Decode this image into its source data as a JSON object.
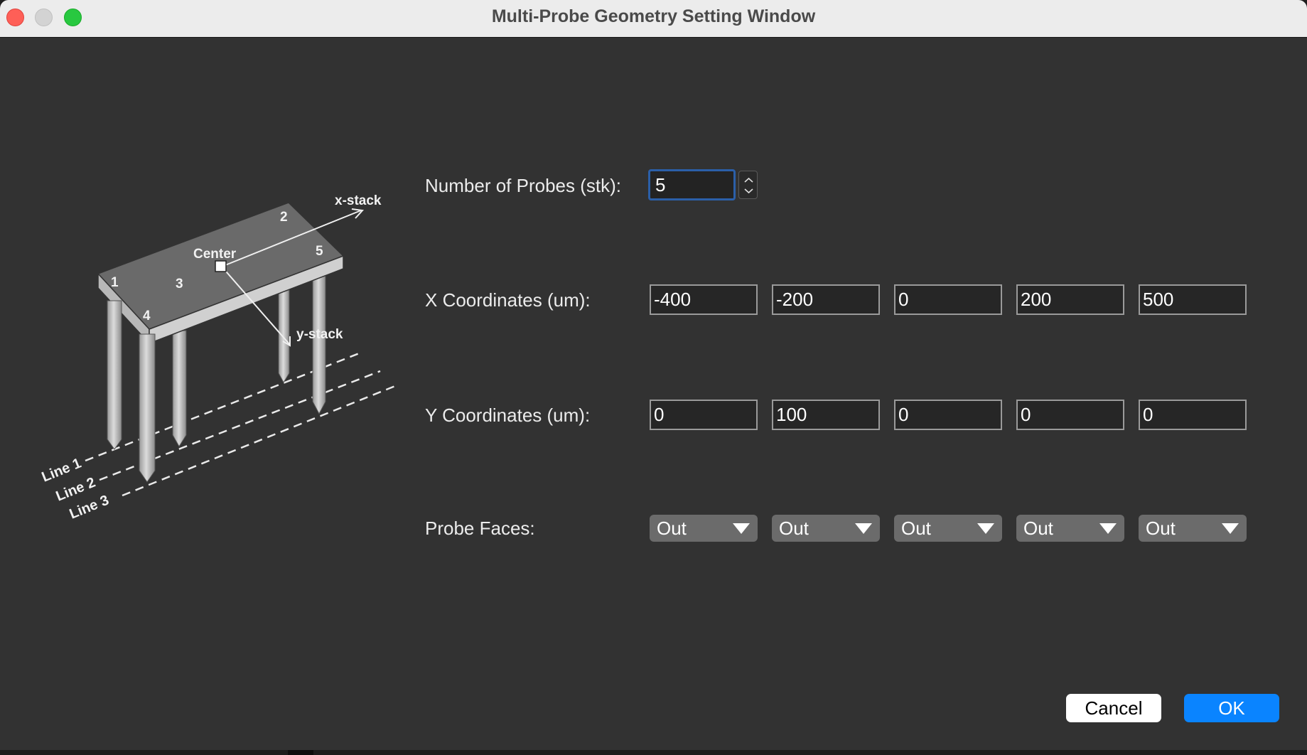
{
  "window": {
    "title": "Multi-Probe Geometry Setting Window"
  },
  "diagram": {
    "labels": {
      "x_stack": "x-stack",
      "y_stack": "y-stack",
      "center": "Center",
      "probe_1": "1",
      "probe_2": "2",
      "probe_3": "3",
      "probe_4": "4",
      "probe_5": "5",
      "line_1": "Line 1",
      "line_2": "Line 2",
      "line_3": "Line 3"
    }
  },
  "form": {
    "num_probes_label": "Number of Probes (stk):",
    "num_probes_value": "5",
    "x_label": "X Coordinates (um):",
    "x_values": [
      "-400",
      "-200",
      "0",
      "200",
      "500"
    ],
    "y_label": "Y Coordinates (um):",
    "y_values": [
      "0",
      "100",
      "0",
      "0",
      "0"
    ],
    "faces_label": "Probe Faces:",
    "faces_values": [
      "Out",
      "Out",
      "Out",
      "Out",
      "Out"
    ]
  },
  "buttons": {
    "cancel": "Cancel",
    "ok": "OK"
  },
  "colors": {
    "accent": "#0a84ff",
    "window_bg": "#323232",
    "focus_ring": "#2b5fa8"
  }
}
